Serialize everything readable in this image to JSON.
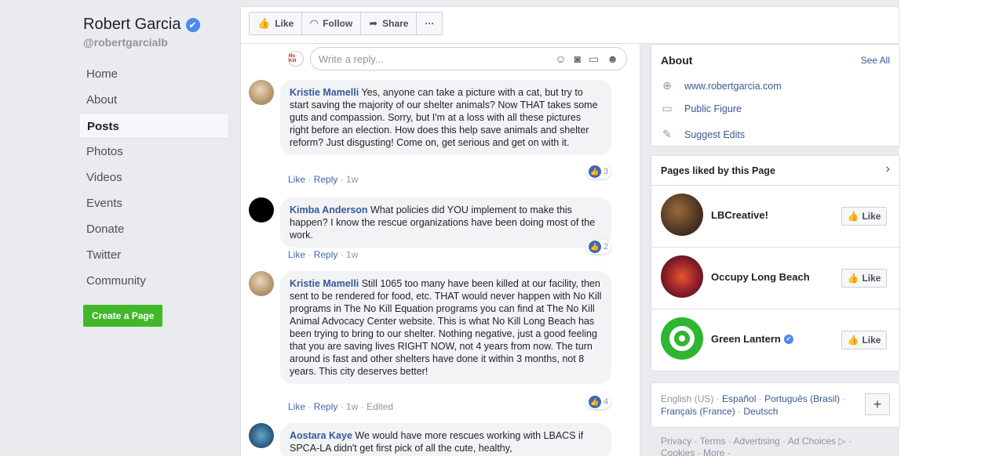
{
  "page": {
    "name": "Robert Garcia",
    "verified_mark": "✔",
    "handle": "@robertgarcialb"
  },
  "nav": [
    "Home",
    "About",
    "Posts",
    "Photos",
    "Videos",
    "Events",
    "Donate",
    "Twitter",
    "Community"
  ],
  "create_page": "Create a Page",
  "actions": {
    "like": "Like",
    "follow": "Follow",
    "share": "Share",
    "more": "···"
  },
  "reply": {
    "avatar_text": "No Kill",
    "placeholder": "Write a reply..."
  },
  "comments": [
    {
      "author": "Kristie Mamelli",
      "text": "Yes, anyone can take a picture with a cat, but try to start saving the majority of our shelter animals? Now THAT takes some guts and compassion. Sorry, but I'm at a loss with all these pictures right before an election. How does this help save animals and shelter reform? Just disgusting! Come on, get serious and get on with it.",
      "like": "Like",
      "reply": "Reply",
      "time": "1w",
      "likes": "3"
    },
    {
      "author": "Kimba Anderson",
      "text": "What policies did YOU implement to make this happen? I know the rescue organizations have been doing most of the work.",
      "like": "Like",
      "reply": "Reply",
      "time": "1w",
      "likes": "2"
    },
    {
      "author": "Kristie Mamelli",
      "text": "Still 1065 too many have been killed at our facility, then sent to be rendered for food, etc. THAT would never happen with No Kill programs in The No Kill Equation programs you can find at The No Kill Animal Advocacy Center website. This is what No Kill Long Beach has been trying to bring to our shelter. Nothing negative, just a good feeling that you are saving lives RIGHT NOW, not 4 years from now. The turn around is fast and other shelters have done it within 3 months, not 8 years. This city deserves better!",
      "like": "Like",
      "reply": "Reply",
      "time": "1w",
      "edited": "Edited",
      "likes": "4"
    },
    {
      "author": "Aostara Kaye",
      "text": "We would have more rescues working with LBACS if SPCA-LA didn't get first pick of all the cute, healthy,"
    }
  ],
  "about": {
    "title": "About",
    "see_all": "See All",
    "website": "www.robertgarcia.com",
    "category": "Public Figure",
    "suggest": "Suggest Edits"
  },
  "pages_liked": {
    "title": "Pages liked by this Page",
    "items": [
      {
        "name": "LBCreative!",
        "like": "Like"
      },
      {
        "name": "Occupy Long Beach",
        "like": "Like"
      },
      {
        "name": "Green Lantern",
        "like": "Like",
        "verified": true
      }
    ]
  },
  "languages": {
    "current": "English (US)",
    "others": [
      "Español",
      "Português (Brasil)",
      "Français (France)",
      "Deutsch"
    ],
    "add": "+"
  },
  "footer": {
    "line1": "Privacy · Terms · Advertising · Ad Choices ▷ ·",
    "line2": "Cookies · More ·"
  },
  "colors": {
    "brand": "#4267b2",
    "link": "#385898",
    "create_green": "#42b72a",
    "verified": "#4b88f0"
  }
}
